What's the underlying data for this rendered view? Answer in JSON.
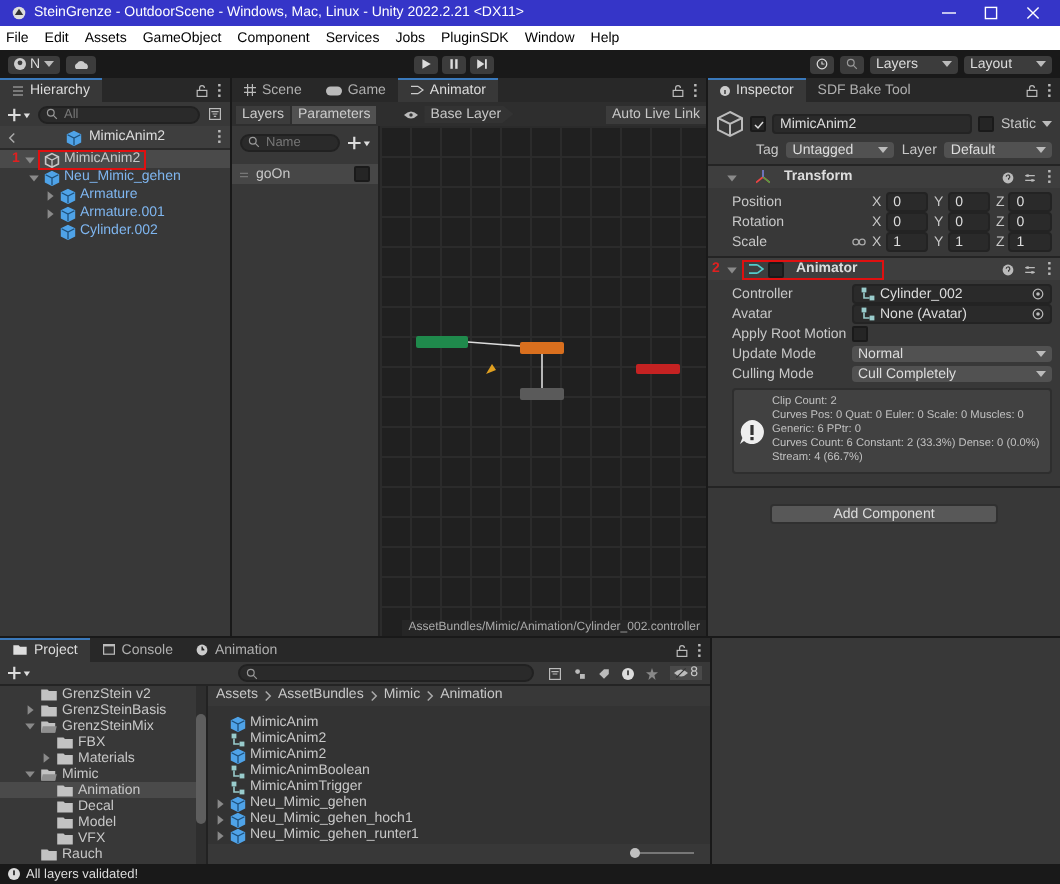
{
  "window": {
    "title": "SteinGrenze - OutdoorScene - Windows, Mac, Linux - Unity 2022.2.21 <DX11>"
  },
  "menu": [
    "File",
    "Edit",
    "Assets",
    "GameObject",
    "Component",
    "Services",
    "Jobs",
    "PluginSDK",
    "Window",
    "Help"
  ],
  "toolbar": {
    "account": "N",
    "layers": "Layers",
    "layout": "Layout"
  },
  "hierarchy": {
    "tab": "Hierarchy",
    "placeholder": "All",
    "scene": "MimicAnim2",
    "tree": [
      {
        "label": "MimicAnim2",
        "kind": "object",
        "selected": true,
        "expandable": true,
        "expanded": true,
        "annotation": "1",
        "children": [
          {
            "label": "Neu_Mimic_gehen",
            "kind": "prefab",
            "selected": false,
            "expandable": true,
            "expanded": true,
            "children": [
              {
                "label": "Armature",
                "kind": "prefab",
                "selected": false,
                "expandable": true,
                "expanded": false
              },
              {
                "label": "Armature.001",
                "kind": "prefab",
                "selected": false,
                "expandable": true,
                "expanded": false
              },
              {
                "label": "Cylinder.002",
                "kind": "prefab",
                "selected": false,
                "expandable": false,
                "expanded": false
              }
            ]
          }
        ]
      }
    ]
  },
  "animator": {
    "tabs": [
      {
        "label": "Scene",
        "kind": "scene",
        "selected": false
      },
      {
        "label": "Game",
        "kind": "game",
        "selected": false
      },
      {
        "label": "Animator",
        "kind": "animator",
        "selected": true
      }
    ],
    "views": [
      {
        "label": "Layers",
        "selected": false
      },
      {
        "label": "Parameters",
        "selected": true
      }
    ],
    "layer": "Base Layer",
    "live_link": "Auto Live Link",
    "placeholder": "Name",
    "parameters": [
      {
        "name": "goOn",
        "checked": false
      }
    ],
    "path": "AssetBundles/Mimic/Animation/Cylinder_002.controller"
  },
  "inspector": {
    "tabs": [
      {
        "label": "Inspector",
        "selected": true
      },
      {
        "label": "SDF Bake Tool",
        "selected": false
      }
    ],
    "active": true,
    "name": "MimicAnim2",
    "static_label": "Static",
    "static": false,
    "tag_label": "Tag",
    "tag": "Untagged",
    "layer_label": "Layer",
    "layer": "Default",
    "components": [
      {
        "kind": "transform",
        "title": "Transform",
        "expanded": true,
        "rows": [
          {
            "label": "Position",
            "link_toggle": false,
            "values": [
              {
                "axis": "X",
                "value": "0"
              },
              {
                "axis": "Y",
                "value": "0"
              },
              {
                "axis": "Z",
                "value": "0"
              }
            ]
          },
          {
            "label": "Rotation",
            "link_toggle": false,
            "values": [
              {
                "axis": "X",
                "value": "0"
              },
              {
                "axis": "Y",
                "value": "0"
              },
              {
                "axis": "Z",
                "value": "0"
              }
            ]
          },
          {
            "label": "Scale",
            "link_toggle": true,
            "values": [
              {
                "axis": "X",
                "value": "1"
              },
              {
                "axis": "Y",
                "value": "1"
              },
              {
                "axis": "Z",
                "value": "1"
              }
            ]
          }
        ]
      },
      {
        "kind": "animator",
        "title": "Animator",
        "expanded": true,
        "enabled": false,
        "annotation": "2",
        "fields": [
          {
            "kind": "object",
            "label": "Controller",
            "value": "Cylinder_002"
          },
          {
            "kind": "object",
            "label": "Avatar",
            "value": "None (Avatar)"
          },
          {
            "kind": "checkbox",
            "label": "Apply Root Motion",
            "checked": false
          },
          {
            "kind": "dropdown",
            "label": "Update Mode",
            "value": "Normal"
          },
          {
            "kind": "dropdown",
            "label": "Culling Mode",
            "value": "Cull Completely"
          }
        ],
        "info": [
          "Clip Count: 2",
          "Curves Pos: 0 Quat: 0 Euler: 0 Scale: 0 Muscles: 0 Generic: 6 PPtr: 0",
          "Curves Count: 6 Constant: 2 (33.3%) Dense: 0 (0.0%)",
          "Stream: 4 (66.7%)"
        ]
      }
    ],
    "add_component": "Add Component"
  },
  "project": {
    "tabs": [
      {
        "label": "Project",
        "kind": "project",
        "selected": true
      },
      {
        "label": "Console",
        "kind": "console",
        "selected": false
      },
      {
        "label": "Animation",
        "kind": "animation",
        "selected": false
      }
    ],
    "hidden_count": "8",
    "folders": [
      {
        "label": "GrenzStein v2",
        "selected": false,
        "expandable": false,
        "expanded": false
      },
      {
        "label": "GrenzSteinBasis",
        "selected": false,
        "expandable": true,
        "expanded": false
      },
      {
        "label": "GrenzSteinMix",
        "selected": false,
        "expandable": true,
        "expanded": true,
        "children": [
          {
            "label": "FBX",
            "selected": false,
            "expandable": false,
            "expanded": false
          },
          {
            "label": "Materials",
            "selected": false,
            "expandable": true,
            "expanded": false
          }
        ]
      },
      {
        "label": "Mimic",
        "selected": false,
        "expandable": true,
        "expanded": true,
        "children": [
          {
            "label": "Animation",
            "selected": true,
            "expandable": false,
            "expanded": false
          },
          {
            "label": "Decal",
            "selected": false,
            "expandable": false,
            "expanded": false
          },
          {
            "label": "Model",
            "selected": false,
            "expandable": false,
            "expanded": false
          },
          {
            "label": "VFX",
            "selected": false,
            "expandable": false,
            "expanded": false
          }
        ]
      },
      {
        "label": "Rauch",
        "selected": false,
        "expandable": false,
        "expanded": false
      }
    ],
    "breadcrumb": [
      "Assets",
      "AssetBundles",
      "Mimic",
      "Animation"
    ],
    "files": [
      {
        "label": "MimicAnim",
        "kind": "prefab",
        "expandable": false
      },
      {
        "label": "MimicAnim2",
        "kind": "controller",
        "expandable": false
      },
      {
        "label": "MimicAnim2",
        "kind": "prefab",
        "expandable": false
      },
      {
        "label": "MimicAnimBoolean",
        "kind": "controller",
        "expandable": false
      },
      {
        "label": "MimicAnimTrigger",
        "kind": "controller",
        "expandable": false
      },
      {
        "label": "Neu_Mimic_gehen",
        "kind": "prefab",
        "expandable": true
      },
      {
        "label": "Neu_Mimic_gehen_hoch1",
        "kind": "prefab",
        "expandable": true
      },
      {
        "label": "Neu_Mimic_gehen_runter1",
        "kind": "prefab",
        "expandable": true
      }
    ],
    "icon_size": {
      "level": 0.05
    }
  },
  "status": "All layers validated!"
}
